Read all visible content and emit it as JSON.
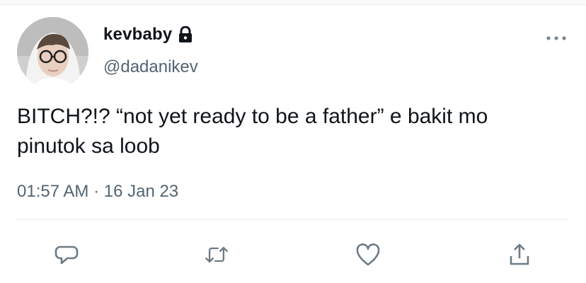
{
  "tweet": {
    "display_name": "kevbaby",
    "handle": "@dadanikev",
    "text": "BITCH?!? “not yet ready to be a father” e bakit mo pinutok sa loob",
    "time": "01:57 AM",
    "separator": "·",
    "date": "16 Jan 23",
    "protected_icon": "lock-icon",
    "more_icon": "more-options-icon"
  },
  "actions": [
    {
      "name": "reply",
      "icon": "reply-icon"
    },
    {
      "name": "retweet",
      "icon": "retweet-icon"
    },
    {
      "name": "like",
      "icon": "heart-icon"
    },
    {
      "name": "share",
      "icon": "share-icon"
    }
  ],
  "colors": {
    "text": "#0f1419",
    "secondary": "#536471",
    "icon": "#6e7a84",
    "divider": "#e8e8e8"
  }
}
